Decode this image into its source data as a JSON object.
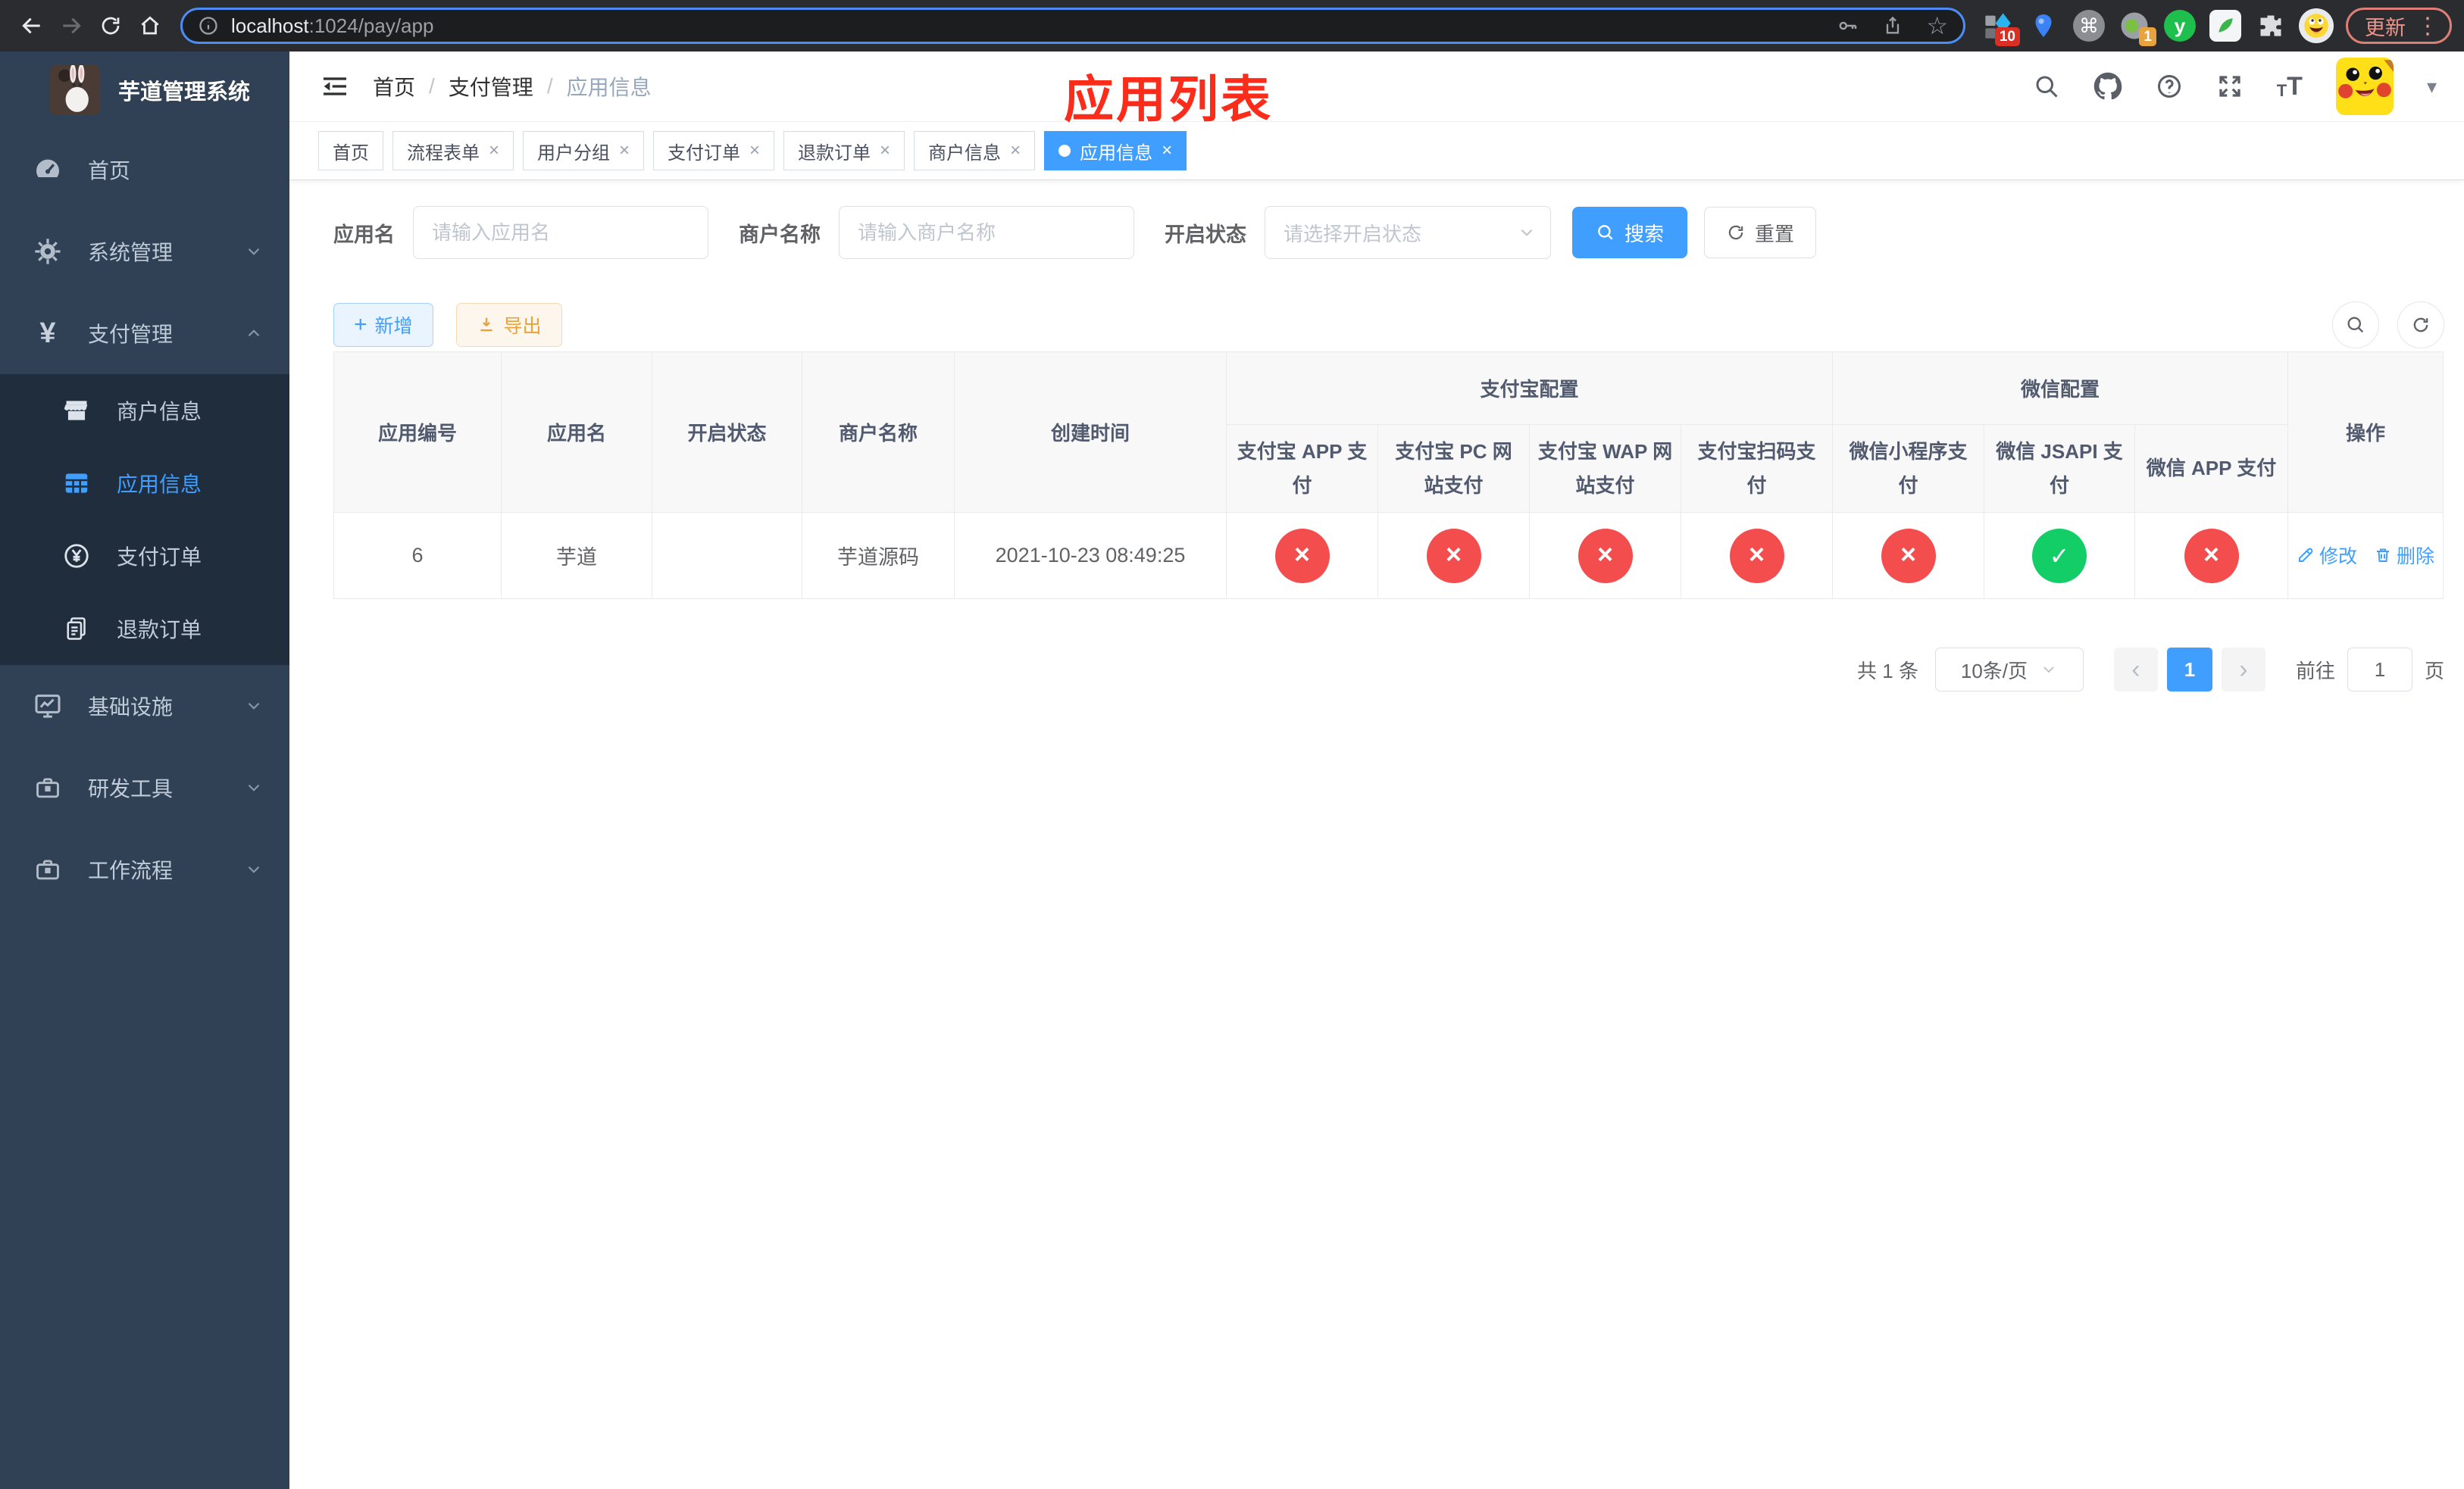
{
  "browser": {
    "url_host": "localhost",
    "url_path": ":1024/pay/app",
    "update_label": "更新",
    "ext_badge_count": "10",
    "ext_badge_one": "1"
  },
  "icons": {
    "star": "☆",
    "caret_down": "▾",
    "dots_vertical": "⋮",
    "command": "⌘",
    "question": "?",
    "font_small": "T",
    "font_large": "T",
    "plus": "+",
    "breadcrumb_sep": "/",
    "prev_arrow": "‹",
    "next_arrow": "›",
    "ext_letter": "y"
  },
  "annotation": {
    "title": "应用列表",
    "color": "#fb2c1a"
  },
  "sidebar": {
    "app_title": "芋道管理系统",
    "menu": [
      {
        "label": "首页"
      },
      {
        "label": "系统管理"
      },
      {
        "label": "支付管理"
      },
      {
        "label": "商户信息"
      },
      {
        "label": "应用信息"
      },
      {
        "label": "支付订单"
      },
      {
        "label": "退款订单"
      },
      {
        "label": "基础设施"
      },
      {
        "label": "研发工具"
      },
      {
        "label": "工作流程"
      }
    ]
  },
  "header": {
    "breadcrumb": [
      "首页",
      "支付管理",
      "应用信息"
    ]
  },
  "tabs": [
    {
      "label": "首页",
      "closable": false,
      "active": false
    },
    {
      "label": "流程表单",
      "closable": true,
      "active": false
    },
    {
      "label": "用户分组",
      "closable": true,
      "active": false
    },
    {
      "label": "支付订单",
      "closable": true,
      "active": false
    },
    {
      "label": "退款订单",
      "closable": true,
      "active": false
    },
    {
      "label": "商户信息",
      "closable": true,
      "active": false
    },
    {
      "label": "应用信息",
      "closable": true,
      "active": true
    }
  ],
  "filters": {
    "app_name_label": "应用名",
    "app_name_placeholder": "请输入应用名",
    "merchant_label": "商户名称",
    "merchant_placeholder": "请输入商户名称",
    "status_label": "开启状态",
    "status_placeholder": "请选择开启状态",
    "search_label": "搜索",
    "reset_label": "重置"
  },
  "toolbar": {
    "add_label": "新增",
    "export_label": "导出"
  },
  "table": {
    "simple_columns": [
      "应用编号",
      "应用名",
      "开启状态",
      "商户名称",
      "创建时间"
    ],
    "groups": [
      {
        "label": "支付宝配置",
        "children": [
          "支付宝 APP 支付",
          "支付宝 PC 网站支付",
          "支付宝 WAP 网站支付",
          "支付宝扫码支付"
        ]
      },
      {
        "label": "微信配置",
        "children": [
          "微信小程序支付",
          "微信 JSAPI 支付",
          "微信 APP 支付"
        ]
      }
    ],
    "actions_label": "操作",
    "rows": [
      {
        "id": "6",
        "name": "芋道",
        "enabled": true,
        "merchant_name": "芋道源码",
        "create_time": "2021-10-23 08:49:25",
        "channels": [
          false,
          false,
          false,
          false,
          false,
          true,
          false
        ],
        "edit_label": "修改",
        "delete_label": "删除"
      }
    ]
  },
  "pagination": {
    "total_label": "共 1 条",
    "page_size_label": "10条/页",
    "page": "1",
    "goto_label": "前往",
    "goto_value": "1",
    "unit_label": "页"
  },
  "colors": {
    "accent": "#409eff",
    "success": "#13ce66",
    "danger": "#f34d4d",
    "sidebar_bg": "#304156",
    "submenu_bg": "#1f2d3d",
    "annotation_red": "#fb2c1a"
  }
}
